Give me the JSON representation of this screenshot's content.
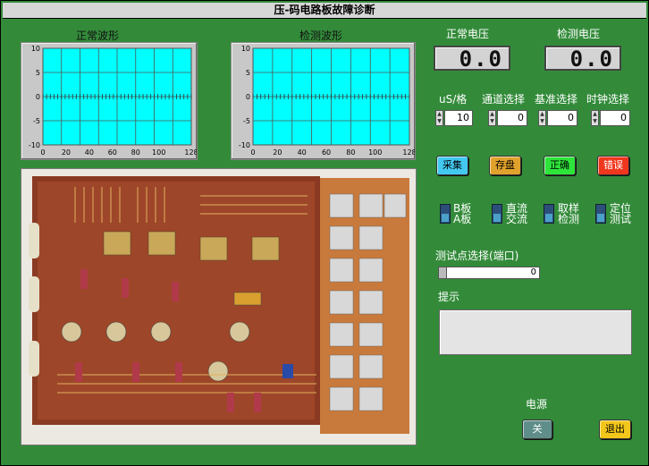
{
  "window": {
    "title": "压-码电路板故障诊断"
  },
  "scopes": [
    {
      "title": "正常波形",
      "y_ticks": [
        "10",
        "5",
        "0",
        "-5",
        "-10"
      ],
      "x_ticks": [
        "0",
        "20",
        "40",
        "60",
        "80",
        "100",
        "128"
      ]
    },
    {
      "title": "检测波形",
      "y_ticks": [
        "10",
        "5",
        "0",
        "-5",
        "-10"
      ],
      "x_ticks": [
        "0",
        "20",
        "40",
        "60",
        "80",
        "100",
        "128"
      ]
    }
  ],
  "meters": {
    "normal_voltage": {
      "label": "正常电压",
      "value": "0.0"
    },
    "measured_voltage": {
      "label": "检测电压",
      "value": "0.0"
    }
  },
  "controls": {
    "time_per_div": {
      "label": "uS/格",
      "value": "10"
    },
    "channel": {
      "label": "通道选择",
      "value": "0"
    },
    "reference": {
      "label": "基准选择",
      "value": "0"
    },
    "clock": {
      "label": "时钟选择",
      "value": "0"
    }
  },
  "buttons": {
    "acquire": {
      "label": "采集",
      "color": "#43c9f0"
    },
    "save": {
      "label": "存盘",
      "color": "#e0a22c"
    },
    "correct": {
      "label": "正确",
      "color": "#2ee43a"
    },
    "error": {
      "label": "错误",
      "color": "#f0361c"
    }
  },
  "toggles": [
    {
      "top": "B板",
      "bottom": "A板"
    },
    {
      "top": "直流",
      "bottom": "交流"
    },
    {
      "top": "取样",
      "bottom": "检测"
    },
    {
      "top": "定位",
      "bottom": "测试"
    }
  ],
  "test_point": {
    "label": "测试点选择(端口)",
    "value": "0"
  },
  "hint": {
    "label": "提示",
    "text": ""
  },
  "power": {
    "label": "电源",
    "off_label": "关",
    "exit_label": "退出",
    "off_color": "#5f8e8a",
    "exit_color": "#f2c61a"
  },
  "colors": {
    "background": "#338b3a",
    "scope_screen": "#00ffff"
  }
}
